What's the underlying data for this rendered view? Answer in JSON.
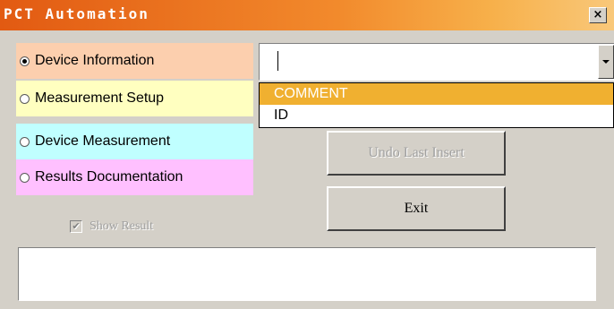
{
  "window": {
    "title": "PCT Automation",
    "close_glyph": "×"
  },
  "radios": [
    {
      "label": "Device Information",
      "checked": true,
      "color": "#fccfae"
    },
    {
      "label": "Measurement Setup",
      "checked": false,
      "color": "#ffffc0"
    },
    {
      "label": "Device Measurement",
      "checked": false,
      "color": "#c0ffff"
    },
    {
      "label": "Results Documentation",
      "checked": false,
      "color": "#ffc0ff"
    }
  ],
  "combo": {
    "value": "",
    "options": [
      "COMMENT",
      "ID"
    ],
    "highlighted": "COMMENT",
    "highlight_color": "#f0b030"
  },
  "buttons": {
    "undo_label": "Undo Last Insert",
    "exit_label": "Exit"
  },
  "show_result": {
    "label": "Show Result",
    "checked": true,
    "enabled": false
  },
  "results_text": ""
}
